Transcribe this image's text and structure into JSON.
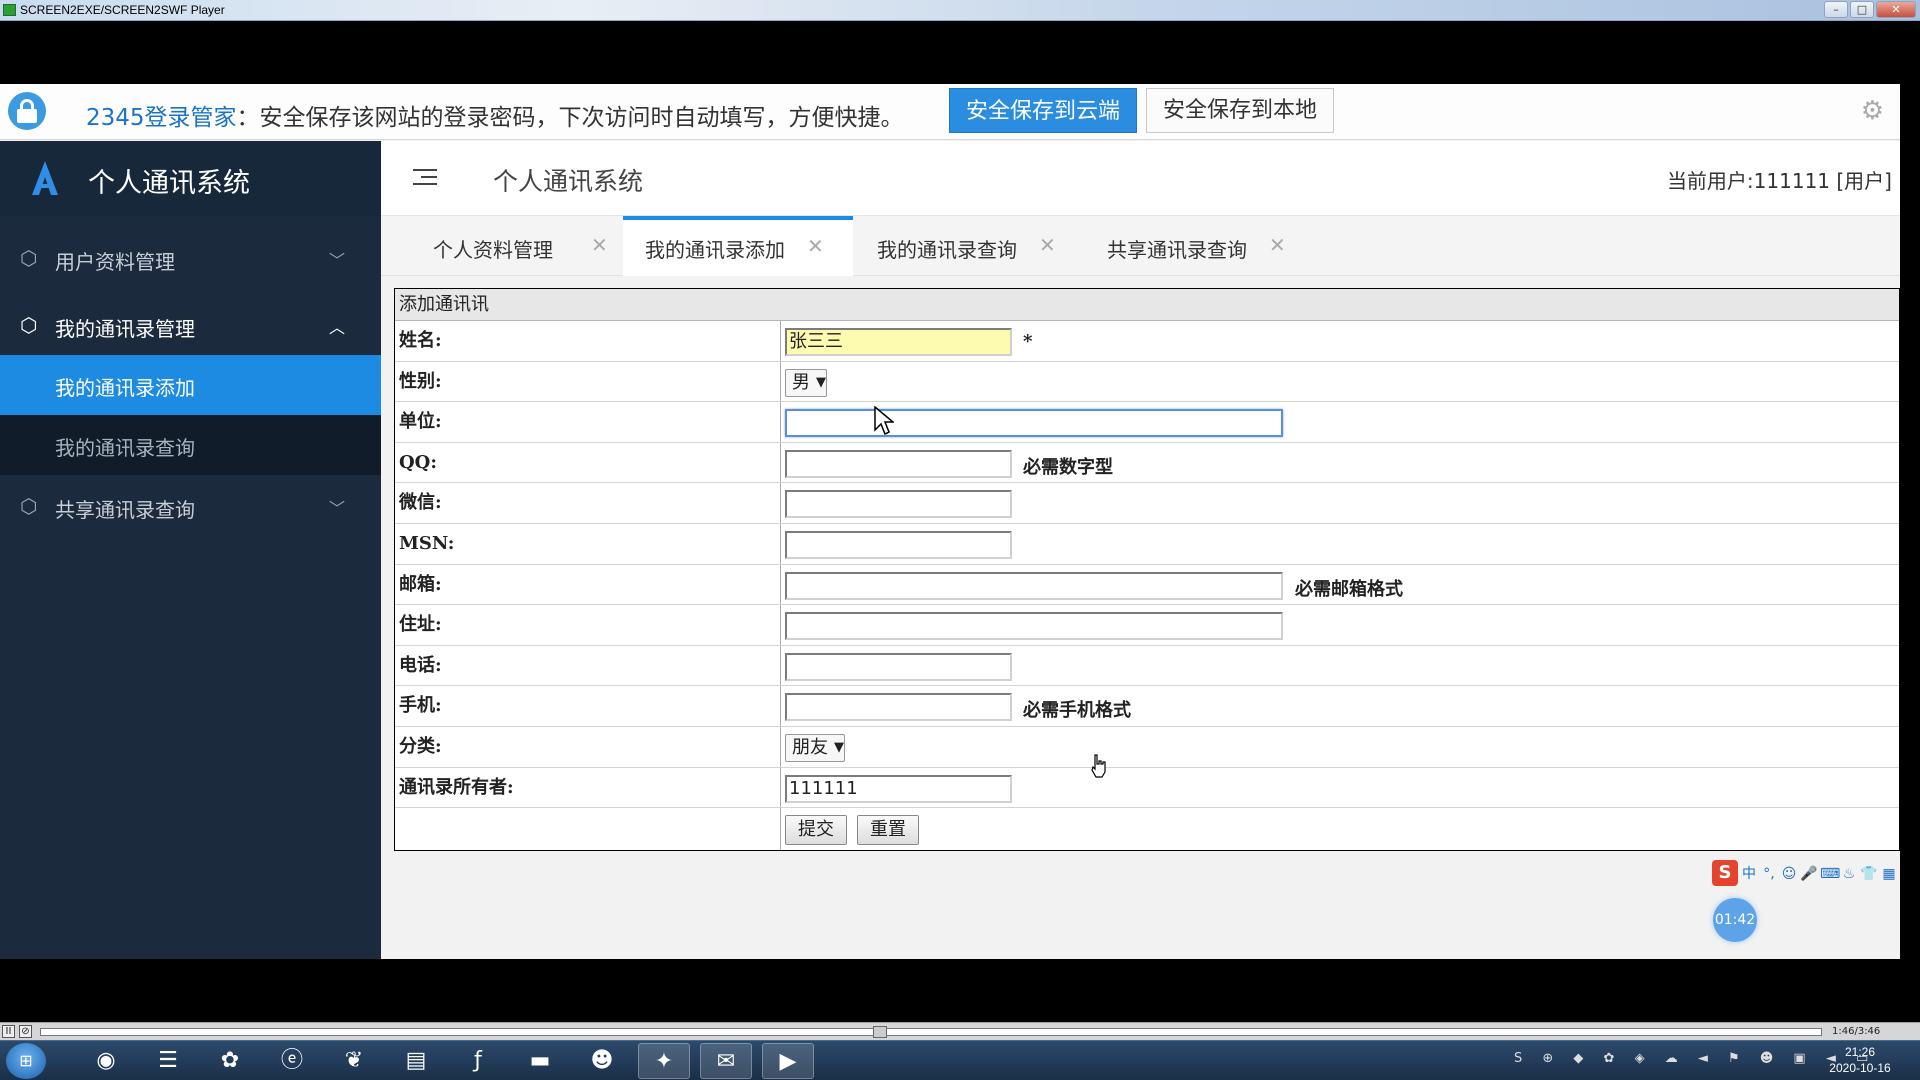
{
  "player": {
    "title": "SCREEN2EXE/SCREEN2SWF Player",
    "win_controls": [
      "–",
      "□",
      "✕"
    ],
    "time_display": "1:46/3:46",
    "pause_glyph": "II",
    "stop_glyph": "⊘"
  },
  "pwbar": {
    "brand": "2345登录管家",
    "message": "：安全保存该网站的登录密码，下次访问时自动填写，方便快捷。",
    "save_cloud_label": "安全保存到云端",
    "save_local_label": "安全保存到本地",
    "settings_icon": "gear-icon"
  },
  "sidebar": {
    "app_title": "个人通讯系统",
    "menus": [
      {
        "label": "用户资料管理",
        "icon": "cube-icon",
        "expanded": false
      },
      {
        "label": "我的通讯录管理",
        "icon": "cube-icon",
        "expanded": true,
        "children": [
          {
            "label": "我的通讯录添加",
            "active": true
          },
          {
            "label": "我的通讯录查询",
            "active": false
          }
        ]
      },
      {
        "label": "共享通讯录查询",
        "icon": "cube-icon",
        "expanded": false
      }
    ],
    "accent": "#1e8be2"
  },
  "header": {
    "title": "个人通讯系统",
    "current_user": "当前用户:111111 [用户]"
  },
  "tabs": [
    {
      "label": "个人资料管理",
      "close": "✕",
      "active": false
    },
    {
      "label": "我的通讯录添加",
      "close": "✕",
      "active": true
    },
    {
      "label": "我的通讯录查询",
      "close": "✕",
      "active": false
    },
    {
      "label": "共享通讯录查询",
      "close": "✕",
      "active": false
    }
  ],
  "form": {
    "caption": "添加通讯讯",
    "fields": {
      "name": {
        "label": "姓名:",
        "value": "张三三",
        "required_mark": "*"
      },
      "gender": {
        "label": "性别:",
        "selected": "男"
      },
      "company": {
        "label": "单位:",
        "value": ""
      },
      "qq": {
        "label": "QQ:",
        "value": "",
        "hint": "必需数字型"
      },
      "wechat": {
        "label": "微信:",
        "value": ""
      },
      "msn": {
        "label": "MSN:",
        "value": ""
      },
      "email": {
        "label": "邮箱:",
        "value": "",
        "hint": "必需邮箱格式"
      },
      "address": {
        "label": "住址:",
        "value": ""
      },
      "phone": {
        "label": "电话:",
        "value": ""
      },
      "mobile": {
        "label": "手机:",
        "value": "",
        "hint": "必需手机格式"
      },
      "category": {
        "label": "分类:",
        "selected": "朋友"
      },
      "owner": {
        "label": "通讯录所有者:",
        "value": "111111"
      }
    },
    "submit_label": "提交",
    "reset_label": "重置"
  },
  "overlays": {
    "ime_logo": "S",
    "ime_items": [
      "中",
      "°,",
      "☺",
      "🎤",
      "⌨",
      "♨",
      "👕",
      "▦"
    ],
    "timer": "01:42"
  },
  "taskbar": {
    "start_glyph": "⊞",
    "apps": [
      {
        "name": "chrome-icon",
        "glyph": "◉"
      },
      {
        "name": "eclipse-icon",
        "glyph": "☰"
      },
      {
        "name": "baidu-netdisk-icon",
        "glyph": "✿"
      },
      {
        "name": "browser-e-icon",
        "glyph": "ⓔ"
      },
      {
        "name": "leaf-app-icon",
        "glyph": "❦"
      },
      {
        "name": "notepad-icon",
        "glyph": "▤"
      },
      {
        "name": "flash-icon",
        "glyph": "ƒ"
      },
      {
        "name": "folder-icon",
        "glyph": "▬"
      },
      {
        "name": "qq-icon",
        "glyph": "☻"
      },
      {
        "name": "game-icon",
        "glyph": "✦"
      },
      {
        "name": "wechat-icon",
        "glyph": "✉"
      },
      {
        "name": "recorder-icon",
        "glyph": "▶"
      }
    ],
    "tray_glyphs": "S ⊕ ◆ ✿ ◈ ☁ ◄ ⚑ ☻ ▣ ◄ ▭",
    "time": "21:26",
    "date": "2020-10-16"
  }
}
